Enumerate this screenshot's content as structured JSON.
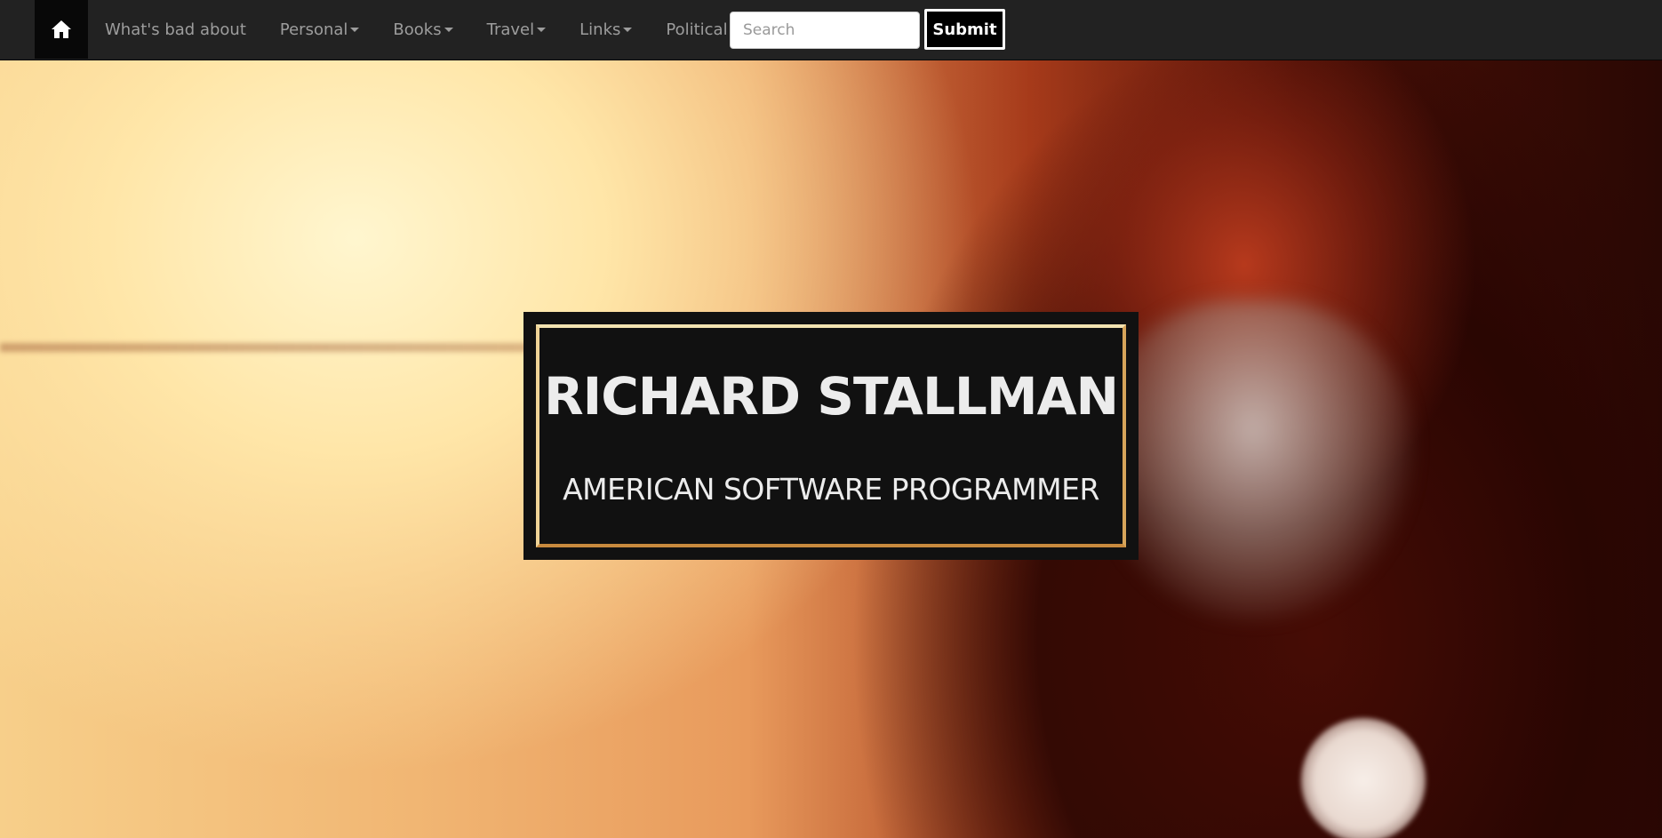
{
  "navbar": {
    "home_icon": "home-icon",
    "items": [
      {
        "label": "What's bad about",
        "has_caret": false
      },
      {
        "label": "Personal",
        "has_caret": true
      },
      {
        "label": "Books",
        "has_caret": true
      },
      {
        "label": "Travel",
        "has_caret": true
      },
      {
        "label": "Links",
        "has_caret": true
      },
      {
        "label": "Political",
        "has_caret": true
      }
    ],
    "search": {
      "placeholder": "Search",
      "value": ""
    },
    "submit_label": "Submit"
  },
  "hero": {
    "name": "RICHARD STALLMAN",
    "subtitle": "AMERICAN SOFTWARE PROGRAMMER"
  },
  "colors": {
    "navbar_bg": "#222222",
    "home_bg": "#080808",
    "nav_text": "#9d9d9d",
    "title_box_bg": "#111111",
    "title_frame": "#e0b46a",
    "title_text": "#ececec"
  }
}
